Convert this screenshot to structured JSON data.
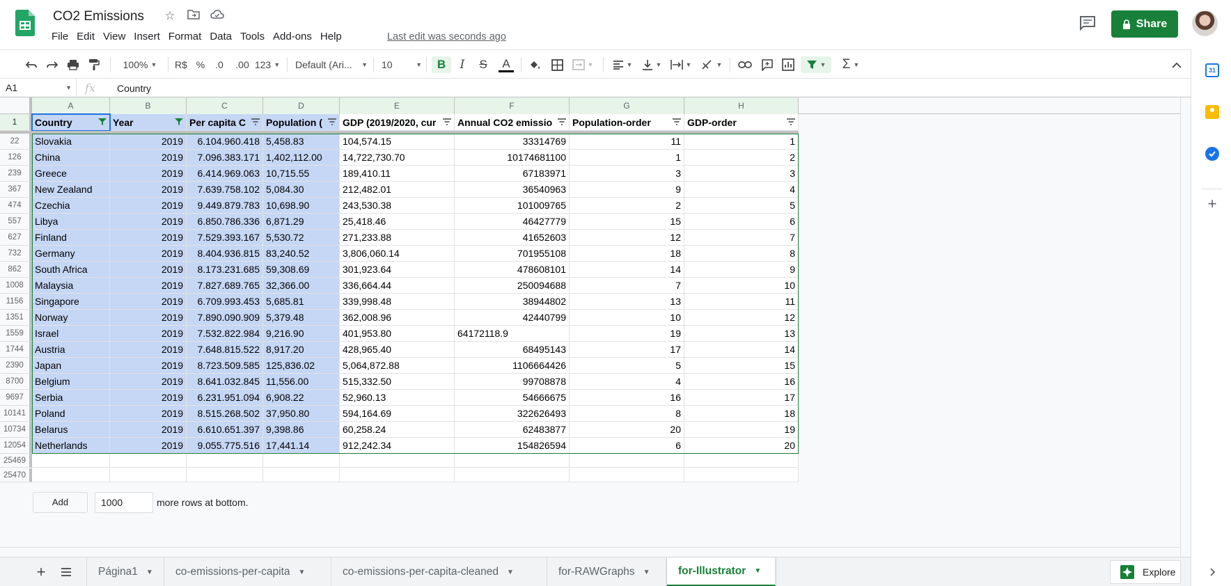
{
  "doc": {
    "title": "CO2 Emissions",
    "last_edit": "Last edit was seconds ago",
    "share_label": "Share"
  },
  "menu": [
    "File",
    "Edit",
    "View",
    "Insert",
    "Format",
    "Data",
    "Tools",
    "Add-ons",
    "Help"
  ],
  "toolbar": {
    "zoom": "100%",
    "currency": "R$",
    "percent": "%",
    "dec_less": ".0",
    "dec_more": ".00",
    "more_formats": "123",
    "font": "Default (Ari...",
    "font_size": "10"
  },
  "formula_bar": {
    "cell_ref": "A1",
    "fx": "fx",
    "value": "Country"
  },
  "columns": [
    "A",
    "B",
    "C",
    "D",
    "E",
    "F",
    "G",
    "H"
  ],
  "header_row": {
    "row_number": "1",
    "cells": [
      "Country",
      "Year",
      "Per capita C",
      "Population (",
      "GDP (2019/2020, cur",
      "Annual CO2 emissio",
      "Population-order",
      "GDP-order"
    ]
  },
  "rows": [
    {
      "n": "22",
      "c": [
        "Slovakia",
        "2019",
        "6.104.960.418",
        "5,458.83",
        "104,574.15",
        "33314769",
        "11",
        "1"
      ]
    },
    {
      "n": "126",
      "c": [
        "China",
        "2019",
        "7.096.383.171",
        "1,402,112.00",
        "14,722,730.70",
        "10174681100",
        "1",
        "2"
      ]
    },
    {
      "n": "239",
      "c": [
        "Greece",
        "2019",
        "6.414.969.063",
        "10,715.55",
        "189,410.11",
        "67183971",
        "3",
        "3"
      ]
    },
    {
      "n": "367",
      "c": [
        "New Zealand",
        "2019",
        "7.639.758.102",
        "5,084.30",
        "212,482.01",
        "36540963",
        "9",
        "4"
      ]
    },
    {
      "n": "474",
      "c": [
        "Czechia",
        "2019",
        "9.449.879.783",
        "10,698.90",
        "243,530.38",
        "101009765",
        "2",
        "5"
      ]
    },
    {
      "n": "557",
      "c": [
        "Libya",
        "2019",
        "6.850.786.336",
        "6,871.29",
        "25,418.46",
        "46427779",
        "15",
        "6"
      ]
    },
    {
      "n": "627",
      "c": [
        "Finland",
        "2019",
        "7.529.393.167",
        "5,530.72",
        "271,233.88",
        "41652603",
        "12",
        "7"
      ]
    },
    {
      "n": "732",
      "c": [
        "Germany",
        "2019",
        "8.404.936.815",
        "83,240.52",
        "3,806,060.14",
        "701955108",
        "18",
        "8"
      ]
    },
    {
      "n": "862",
      "c": [
        "South Africa",
        "2019",
        "8.173.231.685",
        "59,308.69",
        "301,923.64",
        "478608101",
        "14",
        "9"
      ]
    },
    {
      "n": "1008",
      "c": [
        "Malaysia",
        "2019",
        "7.827.689.765",
        "32,366.00",
        "336,664.44",
        "250094688",
        "7",
        "10"
      ]
    },
    {
      "n": "1156",
      "c": [
        "Singapore",
        "2019",
        "6.709.993.453",
        "5,685.81",
        "339,998.48",
        "38944802",
        "13",
        "11"
      ]
    },
    {
      "n": "1351",
      "c": [
        "Norway",
        "2019",
        "7.890.090.909",
        "5,379.48",
        "362,008.96",
        "42440799",
        "10",
        "12"
      ]
    },
    {
      "n": "1559",
      "c": [
        "Israel",
        "2019",
        "7.532.822.984",
        "9,216.90",
        "401,953.80",
        "64172118.9",
        "19",
        "13"
      ]
    },
    {
      "n": "1744",
      "c": [
        "Austria",
        "2019",
        "7.648.815.522",
        "8,917.20",
        "428,965.40",
        "68495143",
        "17",
        "14"
      ]
    },
    {
      "n": "2390",
      "c": [
        "Japan",
        "2019",
        "8.723.509.585",
        "125,836.02",
        "5,064,872.88",
        "1106664426",
        "5",
        "15"
      ]
    },
    {
      "n": "8700",
      "c": [
        "Belgium",
        "2019",
        "8.641.032.845",
        "11,556.00",
        "515,332.50",
        "99708878",
        "4",
        "16"
      ]
    },
    {
      "n": "9697",
      "c": [
        "Serbia",
        "2019",
        "6.231.951.094",
        "6,908.22",
        "52,960.13",
        "54666675",
        "16",
        "17"
      ]
    },
    {
      "n": "10141",
      "c": [
        "Poland",
        "2019",
        "8.515.268.502",
        "37,950.80",
        "594,164.69",
        "322626493",
        "8",
        "18"
      ]
    },
    {
      "n": "10734",
      "c": [
        "Belarus",
        "2019",
        "6.610.651.397",
        "9,398.86",
        "60,258.24",
        "62483877",
        "20",
        "19"
      ]
    },
    {
      "n": "12054",
      "c": [
        "Netherlands",
        "2019",
        "9.055.775.516",
        "17,441.14",
        "912,242.34",
        "154826594",
        "6",
        "20"
      ]
    }
  ],
  "empty_rows": [
    "25469",
    "25470"
  ],
  "add_rows": {
    "button": "Add",
    "value": "1000",
    "suffix": "more rows at bottom."
  },
  "sheets": [
    "Página1",
    "co-emissions-per-capita",
    "co-emissions-per-capita-cleaned",
    "for-RAWGraphs",
    "for-Illustrator"
  ],
  "active_sheet": "for-Illustrator",
  "explore_label": "Explore",
  "colors": {
    "accent": "#188038",
    "selection": "#c6d7f5",
    "active_border": "#1a73e8"
  }
}
